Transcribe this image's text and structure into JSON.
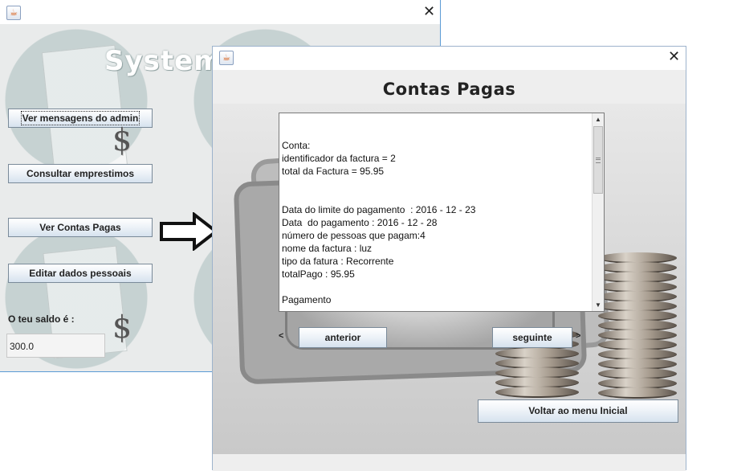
{
  "back_window": {
    "title_fragment": "System",
    "buttons": {
      "admin_messages": "Ver mensagens do admin",
      "consult_loans": "Consultar emprestimos",
      "paid_bills": "Ver Contas Pagas",
      "edit_personal": "Editar dados pessoais"
    },
    "balance_label": "O teu saldo é :",
    "balance_value": "300.0",
    "dollar_glyph": "$"
  },
  "front_window": {
    "heading": "Contas Pagas",
    "bill_text": "Conta:\nidentificador da factura = 2\ntotal da Factura = 95.95\n\n\nData do limite do pagamento  : 2016 - 12 - 23\nData  do pagamento : 2016 - 12 - 28\nnúmero de pessoas que pagam:4\nnome da factura : luz\ntipo da fatura : Recorrente\ntotalPago : 95.95\n\nPagamento",
    "prev_mark": "<",
    "next_mark": ">",
    "buttons": {
      "previous": "anterior",
      "next": "seguinte",
      "back_to_menu": "Voltar ao menu Inicial"
    }
  },
  "icons": {
    "window_icon": "java-cup-icon",
    "close": "close-icon",
    "arrow": "right-arrow-icon"
  },
  "colors": {
    "window_border": "#5b9bd5",
    "button_top": "#ffffff",
    "button_bottom": "#d6e2ee"
  }
}
